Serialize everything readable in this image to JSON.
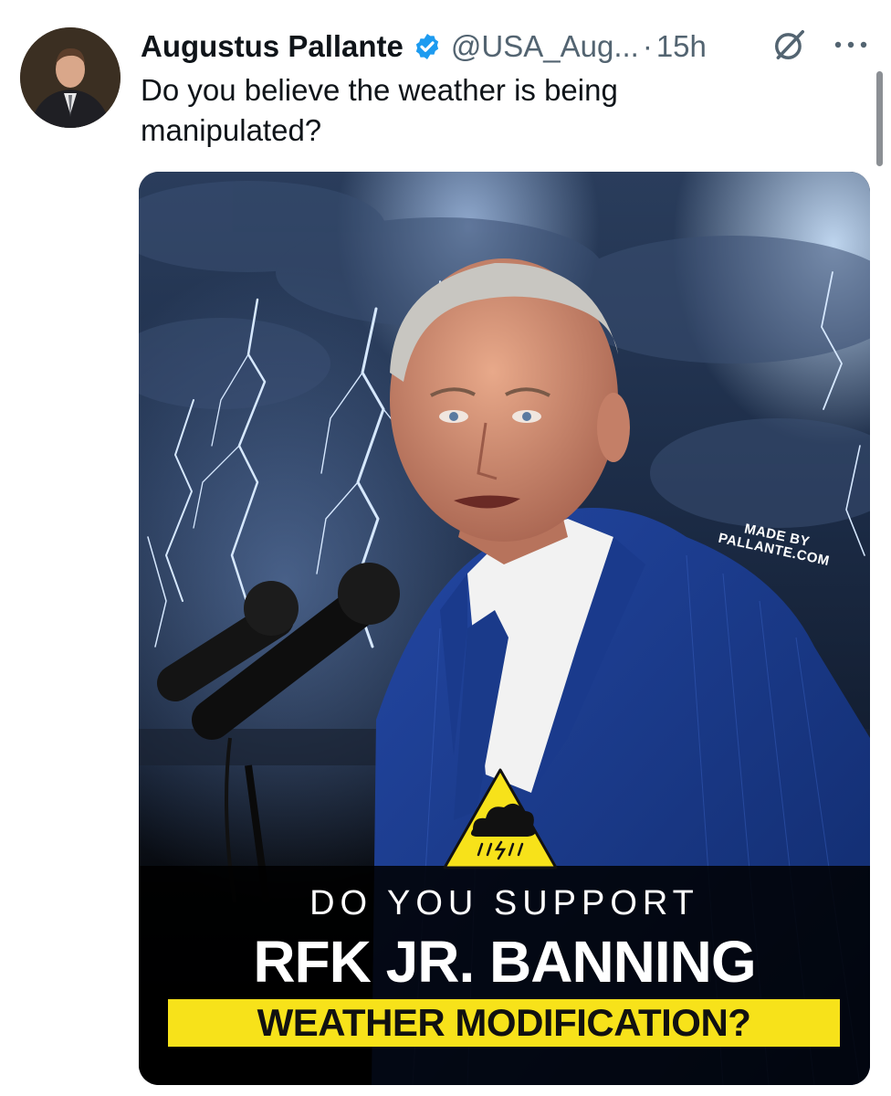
{
  "tweet": {
    "author_name": "Augustus Pallante",
    "handle": "@USA_Aug...",
    "separator": "·",
    "time": "15h",
    "text": "Do you believe the weather is being manipulated?"
  },
  "poster": {
    "watermark_line1": "MADE BY",
    "watermark_line2": "PALLANTE.COM",
    "headline_small": "DO YOU SUPPORT",
    "headline_big": "RFK JR. BANNING",
    "headline_highlight": "WEATHER MODIFICATION?",
    "icons": [
      "weather-warning-icon"
    ]
  },
  "icons": [
    "verified-badge-icon",
    "grok-icon",
    "more-icon"
  ],
  "colors": {
    "verified": "#1d9bf0",
    "highlight": "#f7e21a",
    "muted": "#536471"
  }
}
